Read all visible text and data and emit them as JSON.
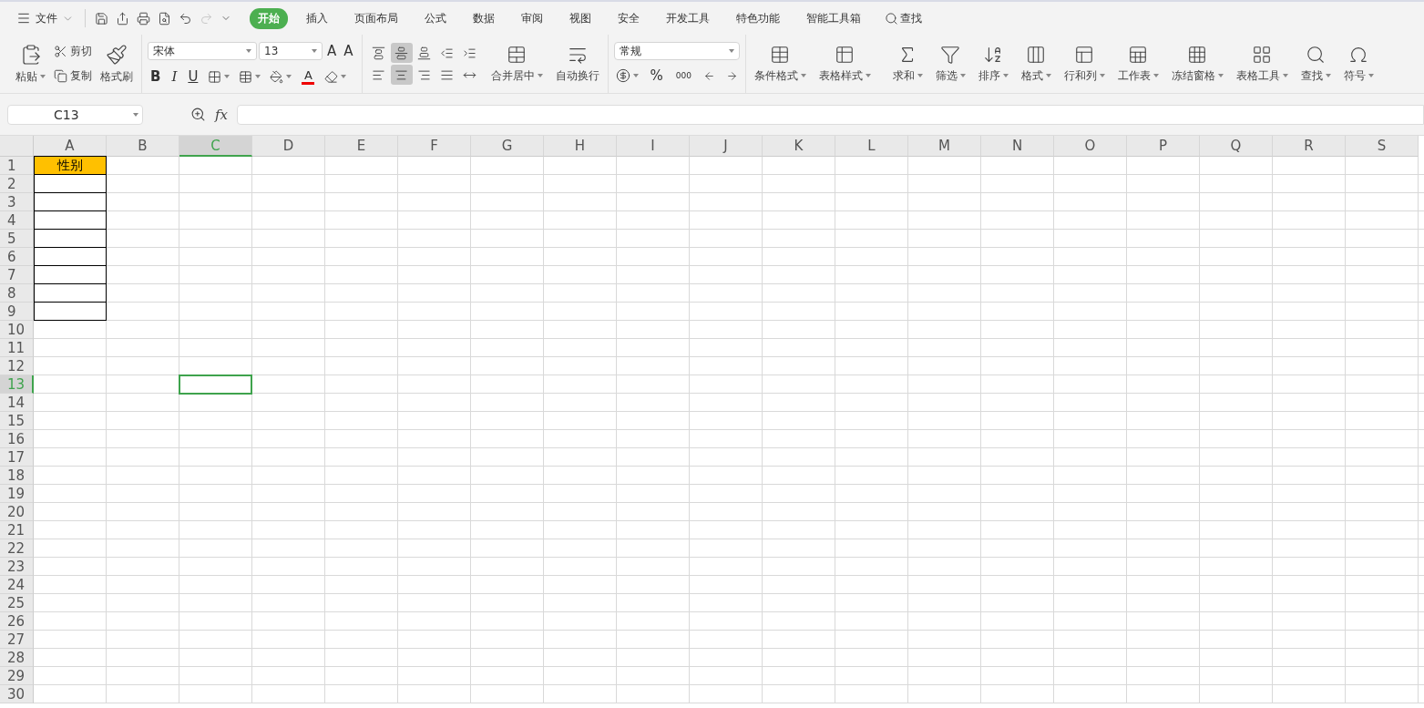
{
  "menu": {
    "file_label": "文件",
    "quick_access": [
      {
        "kind": "save",
        "disabled": false
      },
      {
        "kind": "export",
        "disabled": false
      },
      {
        "kind": "print",
        "disabled": false
      },
      {
        "kind": "preview",
        "disabled": false
      },
      {
        "kind": "undo",
        "disabled": false
      },
      {
        "kind": "redo",
        "disabled": true
      },
      {
        "kind": "more",
        "disabled": false
      }
    ],
    "tabs": [
      {
        "label": "开始",
        "selected": true
      },
      {
        "label": "插入",
        "selected": false
      },
      {
        "label": "页面布局",
        "selected": false
      },
      {
        "label": "公式",
        "selected": false
      },
      {
        "label": "数据",
        "selected": false
      },
      {
        "label": "审阅",
        "selected": false
      },
      {
        "label": "视图",
        "selected": false
      },
      {
        "label": "安全",
        "selected": false
      },
      {
        "label": "开发工具",
        "selected": false
      },
      {
        "label": "特色功能",
        "selected": false
      },
      {
        "label": "智能工具箱",
        "selected": false
      }
    ],
    "search_label": "查找"
  },
  "ribbon": {
    "clipboard": {
      "paste": "粘贴",
      "cut": "剪切",
      "copy": "复制",
      "format_painter": "格式刷"
    },
    "font": {
      "name": "宋体",
      "size": "13",
      "grow": "A",
      "shrink": "A",
      "bold": "B",
      "italic": "I",
      "underline": "U",
      "font_color": "A"
    },
    "alignment": {
      "buttons": [
        {
          "kind": "top",
          "selected": false
        },
        {
          "kind": "middle",
          "selected": true
        },
        {
          "kind": "bottom",
          "selected": false
        },
        {
          "kind": "outdent",
          "selected": false
        },
        {
          "kind": "indent",
          "selected": false
        },
        {
          "kind": "left",
          "selected": false
        },
        {
          "kind": "center",
          "selected": true
        },
        {
          "kind": "right",
          "selected": false
        },
        {
          "kind": "justify",
          "selected": false
        },
        {
          "kind": "distribute",
          "selected": false
        }
      ],
      "merge": "合并居中",
      "wrap": "自动换行"
    },
    "number": {
      "format": "常规",
      "percent": "%",
      "thousands": "000"
    },
    "tools": [
      {
        "kind": "conditional",
        "label": "条件格式"
      },
      {
        "kind": "tablestyle",
        "label": "表格样式"
      },
      {
        "kind": "sum",
        "label": "求和"
      },
      {
        "kind": "filter",
        "label": "筛选"
      },
      {
        "kind": "sort",
        "label": "排序"
      },
      {
        "kind": "format",
        "label": "格式"
      },
      {
        "kind": "rowcol",
        "label": "行和列"
      },
      {
        "kind": "sheet",
        "label": "工作表"
      },
      {
        "kind": "freeze",
        "label": "冻结窗格"
      },
      {
        "kind": "tabletools",
        "label": "表格工具"
      },
      {
        "kind": "find",
        "label": "查找"
      },
      {
        "kind": "symbol",
        "label": "符号"
      }
    ]
  },
  "formula_bar": {
    "name_box": "C13",
    "fx": "fx"
  },
  "sheet": {
    "columns": [
      {
        "label": "A",
        "selected": false
      },
      {
        "label": "B",
        "selected": false
      },
      {
        "label": "C",
        "selected": true
      },
      {
        "label": "D",
        "selected": false
      },
      {
        "label": "E",
        "selected": false
      },
      {
        "label": "F",
        "selected": false
      },
      {
        "label": "G",
        "selected": false
      },
      {
        "label": "H",
        "selected": false
      },
      {
        "label": "I",
        "selected": false
      },
      {
        "label": "J",
        "selected": false
      },
      {
        "label": "K",
        "selected": false
      },
      {
        "label": "L",
        "selected": false
      },
      {
        "label": "M",
        "selected": false
      },
      {
        "label": "N",
        "selected": false
      },
      {
        "label": "O",
        "selected": false
      },
      {
        "label": "P",
        "selected": false
      },
      {
        "label": "Q",
        "selected": false
      },
      {
        "label": "R",
        "selected": false
      },
      {
        "label": "S",
        "selected": false
      }
    ],
    "rows": [
      {
        "label": "1",
        "selected": false,
        "col_a": {
          "text": "性别",
          "highlighted": true,
          "bordered": true
        }
      },
      {
        "label": "2",
        "selected": false,
        "col_a": {
          "highlighted": false,
          "bordered": true
        }
      },
      {
        "label": "3",
        "selected": false,
        "col_a": {
          "highlighted": false,
          "bordered": true
        }
      },
      {
        "label": "4",
        "selected": false,
        "col_a": {
          "highlighted": false,
          "bordered": true
        }
      },
      {
        "label": "5",
        "selected": false,
        "col_a": {
          "highlighted": false,
          "bordered": true
        }
      },
      {
        "label": "6",
        "selected": false,
        "col_a": {
          "highlighted": false,
          "bordered": true
        }
      },
      {
        "label": "7",
        "selected": false,
        "col_a": {
          "highlighted": false,
          "bordered": true
        }
      },
      {
        "label": "8",
        "selected": false,
        "col_a": {
          "highlighted": false,
          "bordered": true
        }
      },
      {
        "label": "9",
        "selected": false,
        "col_a": {
          "highlighted": false,
          "bordered": true
        }
      },
      {
        "label": "10",
        "selected": false
      },
      {
        "label": "11",
        "selected": false
      },
      {
        "label": "12",
        "selected": false
      },
      {
        "label": "13",
        "selected": true
      },
      {
        "label": "14",
        "selected": false
      },
      {
        "label": "15",
        "selected": false
      },
      {
        "label": "16",
        "selected": false
      },
      {
        "label": "17",
        "selected": false
      },
      {
        "label": "18",
        "selected": false
      },
      {
        "label": "19",
        "selected": false
      },
      {
        "label": "20",
        "selected": false
      },
      {
        "label": "21",
        "selected": false
      },
      {
        "label": "22",
        "selected": false
      },
      {
        "label": "23",
        "selected": false
      },
      {
        "label": "24",
        "selected": false
      },
      {
        "label": "25",
        "selected": false
      },
      {
        "label": "26",
        "selected": false
      },
      {
        "label": "27",
        "selected": false
      },
      {
        "label": "28",
        "selected": false
      },
      {
        "label": "29",
        "selected": false
      },
      {
        "label": "30",
        "selected": false
      }
    ]
  }
}
